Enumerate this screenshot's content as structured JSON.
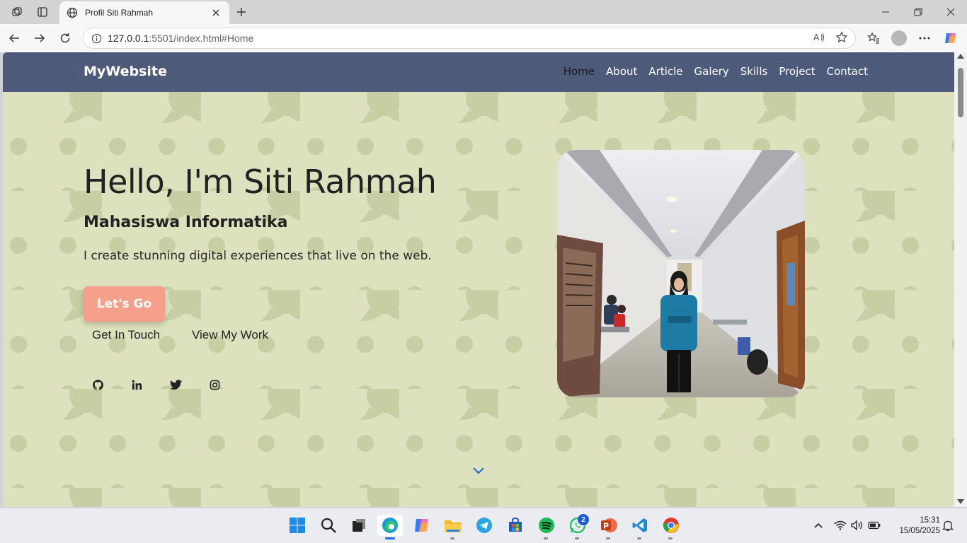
{
  "browser": {
    "tab_title": "Profil Siti Rahmah",
    "url_host": "127.0.0.1",
    "url_rest": ":5501/index.html#Home"
  },
  "site": {
    "brand": "MyWebsite",
    "menu": [
      "Home",
      "About",
      "Article",
      "Galery",
      "Skills",
      "Project",
      "Contact"
    ],
    "active_menu": "Home",
    "hero": {
      "title": "Hello, I'm Siti Rahmah",
      "subtitle": "Mahasiswa Informatika",
      "description": "I create stunning digital experiences that live on the web.",
      "cta": "Let's Go",
      "link_contact": "Get In Touch",
      "link_work": "View My Work"
    },
    "social": [
      "github-icon",
      "linkedin-icon",
      "twitter-icon",
      "instagram-icon"
    ],
    "colors": {
      "nav_bg": "#4e5a7a",
      "page_bg": "#dde1bd",
      "pattern": "#c6cea3",
      "cta": "#f4a08a",
      "scroll_arrow": "#2a6edb"
    }
  },
  "taskbar": {
    "whatsapp_badge": "2",
    "time": "15:31",
    "date": "15/05/2025"
  }
}
